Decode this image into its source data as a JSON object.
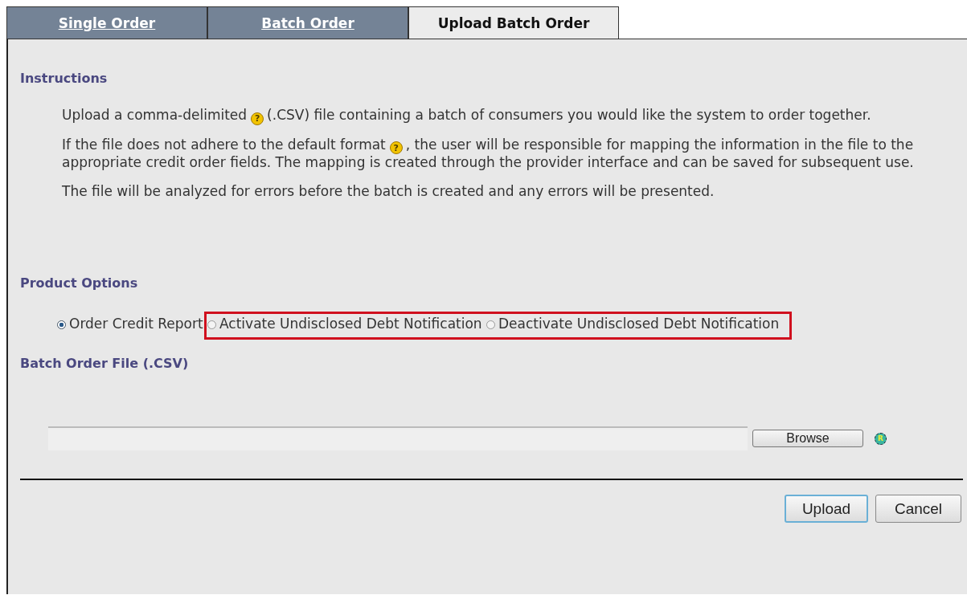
{
  "tabs": [
    {
      "label": "Single Order",
      "selected": false
    },
    {
      "label": "Batch Order",
      "selected": false
    },
    {
      "label": "Upload Batch Order",
      "selected": true
    }
  ],
  "instructions": {
    "heading": "Instructions",
    "paragraphs": [
      {
        "before": "Upload a comma-delimited",
        "help_icon": "?",
        "after": "(.CSV) file containing a batch of consumers you would like the system to order together."
      },
      {
        "before": "If the file does not adhere to the default format",
        "help_icon": "?",
        "after": ", the user will be responsible for mapping the information in the file to the appropriate credit order fields. The mapping is created through the provider interface and can be saved for subsequent use."
      },
      {
        "before": "The file will be analyzed for errors before the batch is created and any errors will be presented."
      }
    ]
  },
  "product_options": {
    "heading": "Product Options",
    "options": [
      {
        "label": "Order Credit Report",
        "selected": true,
        "highlighted": false
      },
      {
        "label": "Activate Undisclosed Debt Notification",
        "selected": false,
        "highlighted": true
      },
      {
        "label": "Deactivate Undisclosed Debt Notification",
        "selected": false,
        "highlighted": true
      }
    ]
  },
  "batch_file": {
    "heading": "Batch Order File (.CSV)",
    "browse": "Browse",
    "required_mark": "R"
  },
  "buttons": [
    "Upload",
    "Cancel"
  ]
}
